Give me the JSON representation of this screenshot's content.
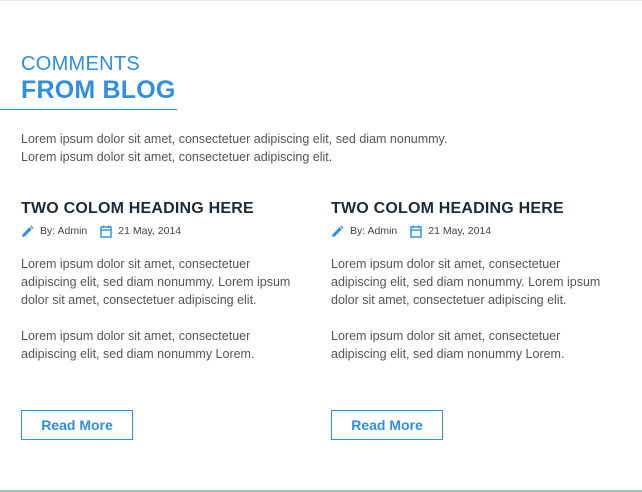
{
  "section": {
    "eyebrow": "COMMENTS",
    "title": "FROM BLOG",
    "intro": "Lorem ipsum dolor sit amet, consectetuer adipiscing elit, sed diam nonummy. Lorem ipsum dolor sit amet, consectetuer adipiscing elit."
  },
  "posts": [
    {
      "title": "TWO COLOM HEADING HERE",
      "author": "By: Admin",
      "date": "21 May, 2014",
      "paragraph1": "Lorem ipsum dolor sit amet, consectetuer adipiscing elit, sed diam nonummy. Lorem ipsum dolor sit amet, consectetuer adipiscing elit.",
      "paragraph2": "Lorem ipsum dolor sit amet, consectetuer adipiscing elit, sed diam nonummy Lorem.",
      "button": "Read More"
    },
    {
      "title": "TWO COLOM HEADING HERE",
      "author": "By: Admin",
      "date": "21 May, 2014",
      "paragraph1": "Lorem ipsum dolor sit amet, consectetuer adipiscing elit, sed diam nonummy. Lorem ipsum dolor sit amet, consectetuer adipiscing elit.",
      "paragraph2": "Lorem ipsum dolor sit amet, consectetuer adipiscing elit, sed diam nonummy Lorem.",
      "button": "Read More"
    }
  ],
  "icons": {
    "author": "pencil-icon",
    "date": "calendar-icon"
  },
  "colors": {
    "accent": "#2f8fe0",
    "heading": "#1e2a3a",
    "body_text": "#555555",
    "bottom_rule": "#8fd1b8"
  }
}
